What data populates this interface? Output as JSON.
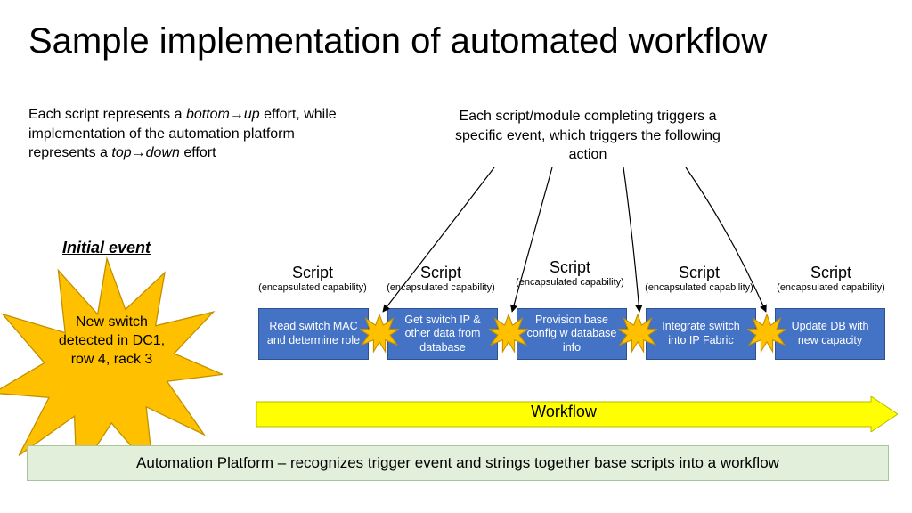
{
  "title": "Sample implementation of automated workflow",
  "intro": {
    "line1a": "Each script represents a ",
    "line1b": "bottom",
    "line1arrow": "→",
    "line1c": "up",
    "line1d": " effort, while implementation of the automation platform represents a ",
    "line1e": "top",
    "line1f": "down",
    "line1g": " effort"
  },
  "callout": "Each script/module completing triggers a specific event, which triggers the following action",
  "initial_event_label": "Initial event",
  "starburst_text": "New switch detected in DC1, row 4, rack 3",
  "scripts": [
    {
      "heading": "Script",
      "sub": "(encapsulated capability)",
      "box": "Read switch MAC and determine role"
    },
    {
      "heading": "Script",
      "sub": "(encapsulated capability)",
      "box": "Get switch IP & other data from database"
    },
    {
      "heading": "Script",
      "sub": "(encapsulated capability)",
      "box": "Provision base config w database info"
    },
    {
      "heading": "Script",
      "sub": "(encapsulated capability)",
      "box": "Integrate switch into IP Fabric"
    },
    {
      "heading": "Script",
      "sub": "(encapsulated capability)",
      "box": "Update DB with new capacity"
    }
  ],
  "workflow_label": "Workflow",
  "platform_text": "Automation Platform – recognizes trigger event and strings together base scripts into a workflow",
  "colors": {
    "box_fill": "#4472C4",
    "box_border": "#2f528f",
    "burst_fill": "#FFC000",
    "arrow_fill": "#FFFF00",
    "arrow_border": "#B8B800",
    "platform_fill": "#E2EFDA"
  }
}
